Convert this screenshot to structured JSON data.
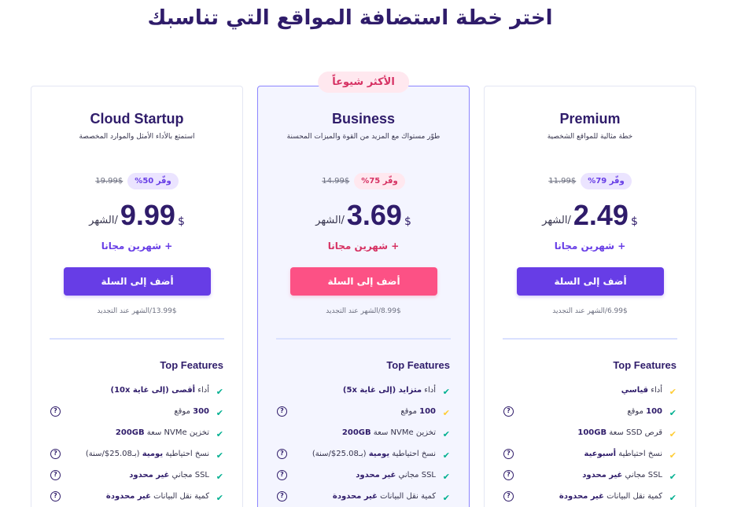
{
  "header": {
    "title": "اختر خطة استضافة المواقع التي تناسبك"
  },
  "colors": {
    "purple": "#673de6",
    "pink": "#fc5185",
    "navy": "#2f1c6a",
    "green_check": "#00b090",
    "yellow_check": "#ffcd35"
  },
  "plans": [
    {
      "name": "Premium",
      "description": "خطة مثالية للمواقع الشخصية",
      "old_price": "11.99$",
      "save_label": "وفّر 79%",
      "currency": "$",
      "price": "2.49",
      "per": "/الشهر",
      "bonus": "+ شهرين مجانا",
      "cta": "أضف إلى السلة",
      "renewal": "6.99$/الشهر عند التجديد",
      "features_title": "Top Features",
      "features": [
        {
          "pre": "أداء ",
          "bold": "قياسي",
          "post": "",
          "check": "yellow",
          "help": false
        },
        {
          "pre": "",
          "bold": "100",
          "post": " موقع",
          "check": "green",
          "help": true
        },
        {
          "pre": "قرص SSD سعة ",
          "bold": "100GB",
          "post": "",
          "check": "yellow",
          "help": false
        },
        {
          "pre": "نسخ احتياطية ",
          "bold": "أسبوعية",
          "post": "",
          "check": "yellow",
          "help": true
        },
        {
          "pre": "SSL مجاني ",
          "bold": "غير محدود",
          "post": "",
          "check": "green",
          "help": true
        },
        {
          "pre": "كمية نقل البيانات ",
          "bold": "غير محدودة",
          "post": "",
          "check": "green",
          "help": true
        }
      ]
    },
    {
      "name": "Business",
      "badge": "الأكثر شيوعاً",
      "description": "طوّر مستواك مع المزيد من القوة والميزات المحسنة",
      "old_price": "14.99$",
      "save_label": "وفّر 75%",
      "currency": "$",
      "price": "3.69",
      "per": "/الشهر",
      "bonus": "+ شهرين مجانا",
      "cta": "أضف إلى السلة",
      "renewal": "8.99$/الشهر عند التجديد",
      "features_title": "Top Features",
      "features": [
        {
          "pre": "أداء ",
          "bold": "متزايد (إلى غاية 5x)",
          "post": "",
          "check": "green",
          "help": false
        },
        {
          "pre": "",
          "bold": "100",
          "post": " موقع",
          "check": "yellow",
          "help": true
        },
        {
          "pre": "تخزين NVMe سعة ",
          "bold": "200GB",
          "post": "",
          "check": "green",
          "help": false
        },
        {
          "pre": "نسخ احتياطية ",
          "bold": "يومية",
          "post": " (بـ25.08$/سنة)",
          "check": "green",
          "help": true
        },
        {
          "pre": "SSL مجاني ",
          "bold": "غير محدود",
          "post": "",
          "check": "green",
          "help": true
        },
        {
          "pre": "كمية نقل البيانات ",
          "bold": "غير محدودة",
          "post": "",
          "check": "green",
          "help": true
        }
      ]
    },
    {
      "name": "Cloud Startup",
      "description": "استمتع بالأداء الأمثل والموارد المخصصة",
      "old_price": "19.99$",
      "save_label": "وفّر 50%",
      "currency": "$",
      "price": "9.99",
      "per": "/الشهر",
      "bonus": "+ شهرين مجانا",
      "cta": "أضف إلى السلة",
      "renewal": "13.99$/الشهر عند التجديد",
      "features_title": "Top Features",
      "features": [
        {
          "pre": "أداء ",
          "bold": "أقصى (إلى غاية 10x)",
          "post": "",
          "check": "green",
          "help": false
        },
        {
          "pre": "",
          "bold": "300",
          "post": " موقع",
          "check": "green",
          "help": true
        },
        {
          "pre": "تخزين NVMe سعة ",
          "bold": "200GB",
          "post": "",
          "check": "green",
          "help": false
        },
        {
          "pre": "نسخ احتياطية ",
          "bold": "يومية",
          "post": " (بـ25.08$/سنة)",
          "check": "green",
          "help": true
        },
        {
          "pre": "SSL مجاني ",
          "bold": "غير محدود",
          "post": "",
          "check": "green",
          "help": true
        },
        {
          "pre": "كمية نقل البيانات ",
          "bold": "غير محدودة",
          "post": "",
          "check": "green",
          "help": true
        }
      ]
    }
  ]
}
